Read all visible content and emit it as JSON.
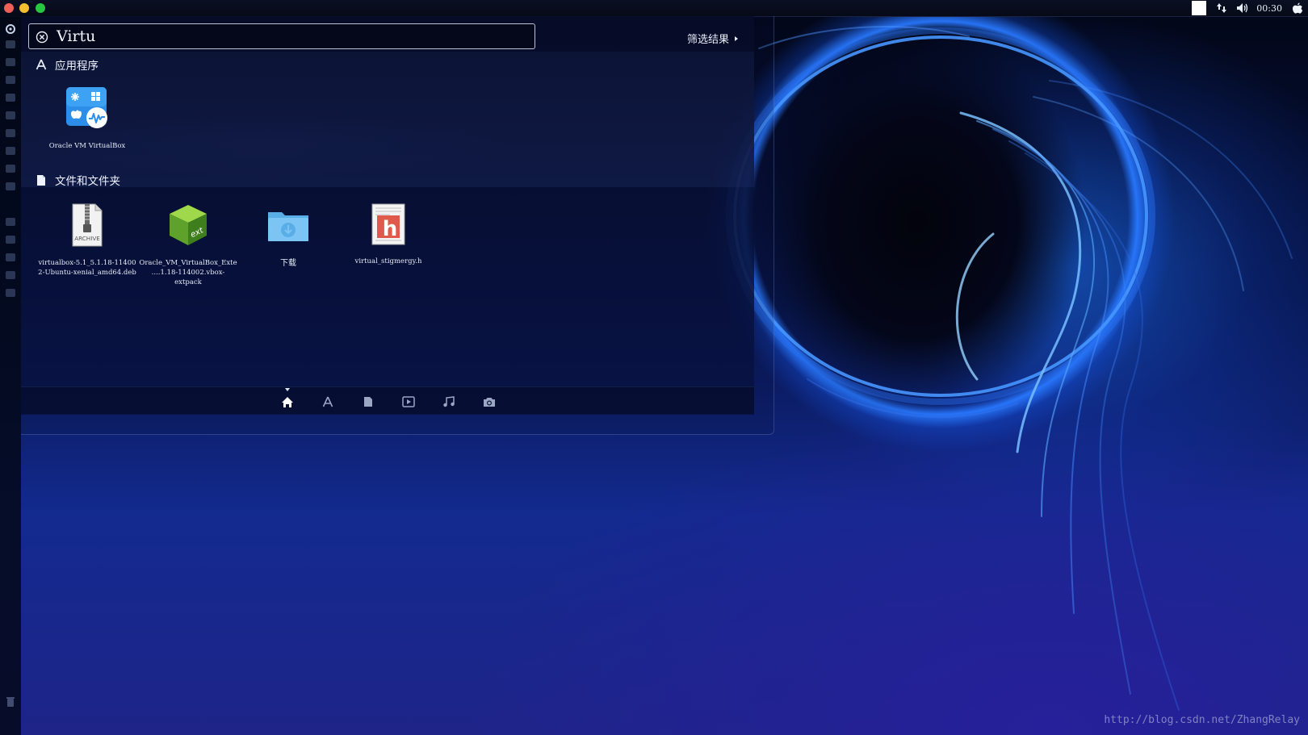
{
  "menubar": {
    "clock": "00:30",
    "icons": [
      "white-square-indicator",
      "network-icon",
      "volume-icon",
      "apple-icon"
    ]
  },
  "launcher": {
    "icons": [
      "settings-icon",
      "trash-icon"
    ]
  },
  "dash": {
    "search": {
      "value": "Virtu"
    },
    "filter_label": "筛选结果",
    "sections": {
      "apps": {
        "title": "应用程序",
        "items": [
          {
            "label": "Oracle VM VirtualBox",
            "icon": "virtualbox-icon"
          }
        ]
      },
      "files": {
        "title": "文件和文件夹",
        "items": [
          {
            "label": "virtualbox-5.1_5.1.18-11400\n2-Ubuntu-xenial_amd64.deb",
            "icon": "archive-icon",
            "icon_text": "ARCHIVE"
          },
          {
            "label": "Oracle_VM_VirtualBox_Exte\n....1.18-114002.vbox-extpack",
            "icon": "extpack-cube-icon",
            "icon_text": "ext"
          },
          {
            "label": "下载",
            "icon": "download-folder-icon"
          },
          {
            "label": "virtual_stigmergy.h",
            "icon": "c-header-file-icon",
            "icon_text": "h"
          }
        ]
      }
    },
    "lenses": [
      "home-lens",
      "applications-lens",
      "files-lens",
      "video-lens",
      "music-lens",
      "photo-lens"
    ]
  },
  "colors": {
    "close": "#ee5f57",
    "minimize": "#f5bf30",
    "maximize": "#27c840",
    "accent": "#2e7cff"
  },
  "watermark": "http://blog.csdn.net/ZhangRelay"
}
